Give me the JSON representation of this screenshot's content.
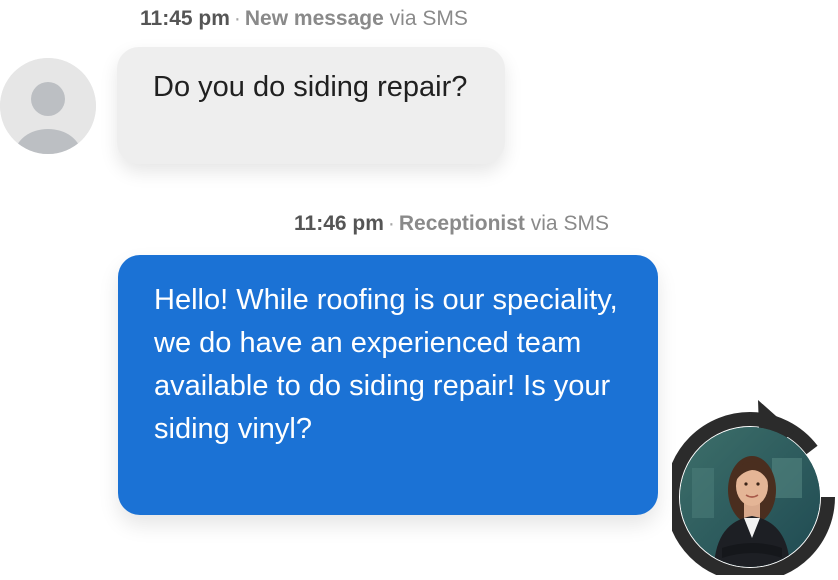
{
  "incoming": {
    "time": "11:45 pm",
    "separator": "·",
    "sender": "New message",
    "channel": "via SMS",
    "text": "Do you do siding repair?",
    "avatar_icon": "person-placeholder-icon"
  },
  "outgoing": {
    "time": "11:46 pm",
    "separator": "·",
    "sender": "Receptionist",
    "channel": "via SMS",
    "text": "Hello! While roofing is our speciality, we do have an experienced team available to do siding repair! Is your siding vinyl?",
    "avatar_icon": "receptionist-avatar-icon",
    "ring_icon": "circular-arrow-icon"
  },
  "colors": {
    "outgoing_bubble": "#1b72d5",
    "incoming_bubble": "#eeeeee",
    "meta_text": "#8a8a8a"
  }
}
